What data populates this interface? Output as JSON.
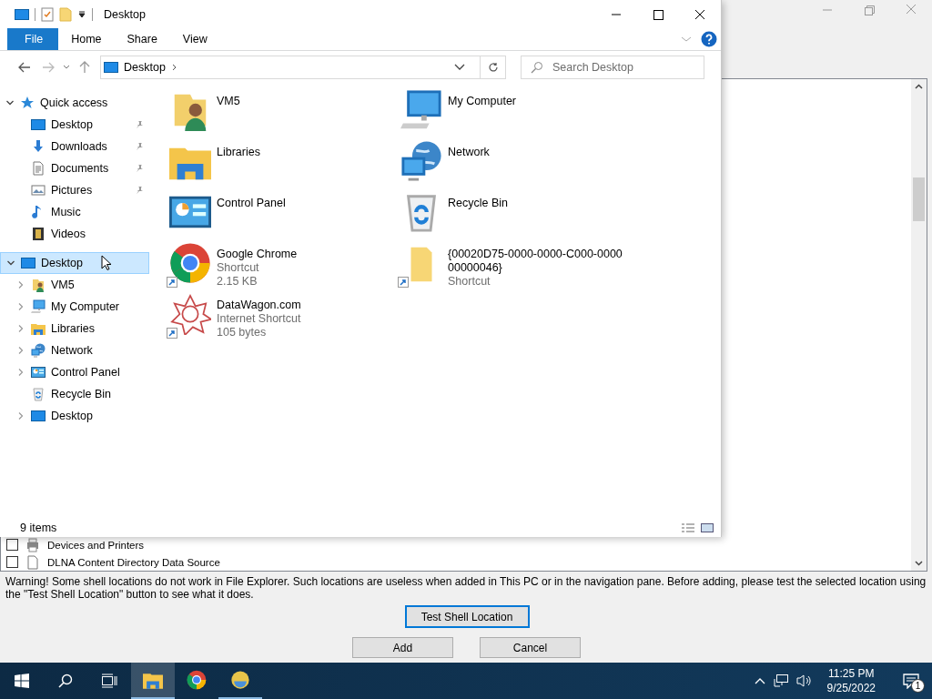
{
  "explorer": {
    "title": "Desktop",
    "ribbon_tabs": [
      {
        "label": "File",
        "kind": "menu"
      },
      {
        "label": "Home",
        "kind": "tab"
      },
      {
        "label": "Share",
        "kind": "tab"
      },
      {
        "label": "View",
        "kind": "tab"
      }
    ],
    "address": "Desktop",
    "search": {
      "placeholder": "Search Desktop"
    },
    "navigation": [
      {
        "label": "Quick access",
        "kind": "star",
        "expandable": true,
        "expanded": true,
        "selected": false,
        "children": [
          {
            "label": "Desktop",
            "kind": "desktop",
            "expandable": false,
            "selected": false,
            "pinned": true
          },
          {
            "label": "Downloads",
            "kind": "downloads",
            "expandable": false,
            "selected": false,
            "pinned": true
          },
          {
            "label": "Documents",
            "kind": "documents",
            "expandable": false,
            "selected": false,
            "pinned": true
          },
          {
            "label": "Pictures",
            "kind": "pictures",
            "expandable": false,
            "selected": false,
            "pinned": true
          },
          {
            "label": "Music",
            "kind": "music",
            "expandable": false,
            "selected": false,
            "pinned": false
          },
          {
            "label": "Videos",
            "kind": "videos",
            "expandable": false,
            "selected": false,
            "pinned": false
          }
        ]
      },
      {
        "label": "Desktop",
        "kind": "desktop",
        "expandable": true,
        "expanded": true,
        "selected": true,
        "children": [
          {
            "label": "VM5",
            "kind": "user",
            "expandable": true,
            "expanded": false,
            "selected": false
          },
          {
            "label": "My Computer",
            "kind": "computer",
            "expandable": true,
            "expanded": false,
            "selected": false
          },
          {
            "label": "Libraries",
            "kind": "libraries",
            "expandable": true,
            "expanded": false,
            "selected": false
          },
          {
            "label": "Network",
            "kind": "network",
            "expandable": true,
            "expanded": false,
            "selected": false
          },
          {
            "label": "Control Panel",
            "kind": "control-panel",
            "expandable": true,
            "expanded": false,
            "selected": false
          },
          {
            "label": "Recycle Bin",
            "kind": "recycle-bin",
            "expandable": false,
            "selected": false
          },
          {
            "label": "Desktop",
            "kind": "desktop",
            "expandable": true,
            "expanded": false,
            "selected": false
          }
        ]
      }
    ],
    "items": [
      {
        "name": "VM5",
        "kind": "user",
        "shortcut": false
      },
      {
        "name": "My Computer",
        "kind": "computer",
        "shortcut": false
      },
      {
        "name": "Libraries",
        "kind": "libraries",
        "shortcut": false
      },
      {
        "name": "Network",
        "kind": "network",
        "shortcut": false
      },
      {
        "name": "Control Panel",
        "kind": "control-panel",
        "shortcut": false
      },
      {
        "name": "Recycle Bin",
        "kind": "recycle-bin",
        "shortcut": false
      },
      {
        "name": "Google Chrome",
        "kind": "chrome",
        "shortcut": true,
        "details": [
          "Shortcut",
          "2.15 KB"
        ]
      },
      {
        "name": "{00020D75-0000-0000-C000-000000000046}",
        "kind": "folder",
        "shortcut": true,
        "details": [
          "Shortcut"
        ]
      },
      {
        "name": "DataWagon.com",
        "kind": "web",
        "shortcut": true,
        "details": [
          "Internet Shortcut",
          "105 bytes"
        ]
      }
    ],
    "status": "9 items"
  },
  "dialog": {
    "list_items": [
      {
        "label": "Devices and Printers",
        "kind": "printer",
        "checked": false
      },
      {
        "label": "DLNA Content Directory Data Source",
        "kind": "document",
        "checked": false
      }
    ],
    "warning": "Warning! Some shell locations do not work in File Explorer. Such locations are useless when added in This PC or in the navigation pane. Before adding, please test the selected location using the \"Test Shell Location\" button to see what it does.",
    "buttons": [
      {
        "label": "Test Shell Location",
        "default": true
      },
      {
        "label": "Add",
        "default": false
      },
      {
        "label": "Cancel",
        "default": false
      }
    ]
  },
  "taskbar": {
    "apps": [
      {
        "kind": "explorer",
        "active": true,
        "running": true
      },
      {
        "kind": "chrome",
        "active": false,
        "running": false
      },
      {
        "kind": "app",
        "active": false,
        "running": true
      }
    ],
    "time": "11:25 PM",
    "date": "9/25/2022",
    "notifications": "1"
  }
}
